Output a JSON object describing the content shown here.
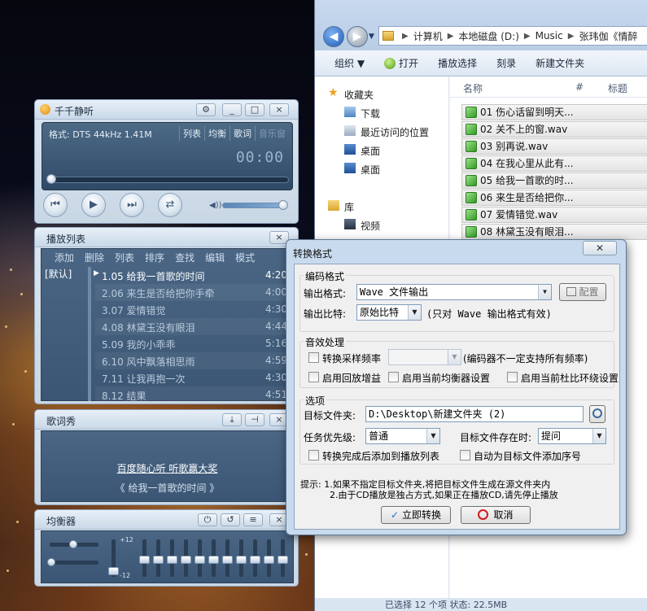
{
  "explorer": {
    "breadcrumb": [
      "计算机",
      "本地磁盘 (D:)",
      "Music",
      "张玮伽《情醉"
    ],
    "toolbar": [
      "组织 ▼",
      "打开",
      "播放选择",
      "刻录",
      "新建文件夹"
    ],
    "nav": {
      "favorites": "收藏夹",
      "downloads": "下载",
      "recent": "最近访问的位置",
      "desktop1": "桌面",
      "desktop2": "桌面",
      "library": "库",
      "videos": "视频"
    },
    "columns": {
      "name": "名称",
      "num": "#",
      "title": "标题"
    },
    "files": [
      "01 伤心话留到明天...",
      "02 关不上的窗.wav",
      "03 别再说.wav",
      "04 在我心里从此有...",
      "05 给我一首歌的时...",
      "06 来生是否给把你...",
      "07 爱情错觉.wav",
      "08 林黛玉没有眼泪..."
    ],
    "status": "已选择 12 个项  状态: 22.5MB"
  },
  "player": {
    "title": "千千静听",
    "format": "格式: DTS 44kHz 1.41M",
    "tabs": [
      "列表",
      "均衡",
      "歌词",
      "音乐窗"
    ],
    "time": "00:00",
    "position_fraction": 0,
    "volume_fraction": 1.0,
    "buttons": {
      "settings": "⚙",
      "minimize": "_",
      "maximize": "□",
      "close": "×"
    }
  },
  "playlist": {
    "title": "播放列表",
    "menu": [
      "添加",
      "删除",
      "列表",
      "排序",
      "查找",
      "编辑",
      "模式"
    ],
    "group": "[默认]",
    "tracks": [
      {
        "title": "1.05 给我一首歌的时间",
        "duration": "4:20",
        "current": true
      },
      {
        "title": "2.06 来生是否给把你手牵",
        "duration": "4:00"
      },
      {
        "title": "3.07 爱情错觉",
        "duration": "4:30"
      },
      {
        "title": "4.08 林黛玉没有眼泪",
        "duration": "4:44"
      },
      {
        "title": "5.09 我的小乖乖",
        "duration": "5:16"
      },
      {
        "title": "6.10 风中飘落相思雨",
        "duration": "4:59"
      },
      {
        "title": "7.11 让我再抱一次",
        "duration": "4:30"
      },
      {
        "title": "8.12 结果",
        "duration": "4:51"
      }
    ]
  },
  "lyrics": {
    "title": "歌词秀",
    "link": "百度随心听  听歌赢大奖",
    "song": "《 给我一首歌的时间 》"
  },
  "equalizer": {
    "title": "均衡器",
    "scale_top": "+12",
    "scale_bottom": "-12"
  },
  "dialog": {
    "title": "转换格式",
    "close": "✕",
    "encoding": {
      "group": "编码格式",
      "output_format_label": "输出格式:",
      "output_format_value": "Wave 文件输出",
      "config_button": "配置",
      "bitrate_label": "输出比特:",
      "bitrate_value": "原始比特",
      "bitrate_note": "(只对 Wave 输出格式有效)"
    },
    "effects": {
      "group": "音效处理",
      "resample": "转换采样频率",
      "resample_note": "(编码器不一定支持所有频率)",
      "replay_gain": "启用回放增益",
      "use_eq": "启用当前均衡器设置",
      "use_surround": "启用当前杜比环绕设置"
    },
    "options": {
      "group": "选项",
      "target_label": "目标文件夹:",
      "target_value": "D:\\Desktop\\新建文件夹 (2)",
      "priority_label": "任务优先级:",
      "priority_value": "普通",
      "exists_label": "目标文件存在时:",
      "exists_value": "提问",
      "add_to_playlist": "转换完成后添加到播放列表",
      "add_serial": "自动为目标文件添加序号"
    },
    "hint_1": "提示: 1.如果不指定目标文件夹,将把目标文件生成在源文件夹内",
    "hint_2": "2.由于CD播放是独占方式,如果正在播放CD,请先停止播放",
    "ok_button": "立即转换",
    "cancel_button": "取消"
  }
}
